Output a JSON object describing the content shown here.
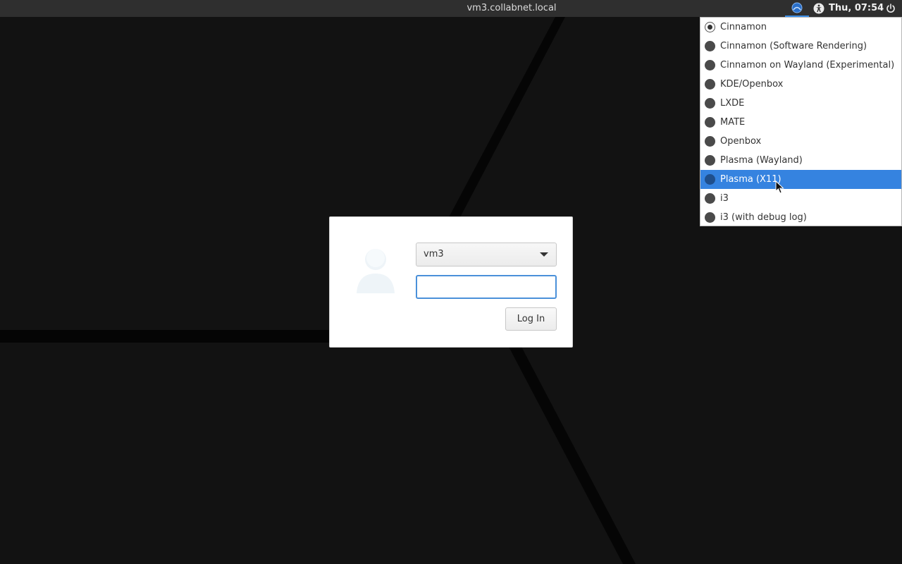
{
  "panel": {
    "hostname": "vm3.collabnet.local",
    "clock": "Thu, 07:54",
    "session_icon": "session-icon",
    "accessibility_icon": "accessibility-icon",
    "power_icon": "power-icon"
  },
  "session_menu": {
    "items": [
      {
        "label": "Cinnamon"
      },
      {
        "label": "Cinnamon (Software Rendering)"
      },
      {
        "label": "Cinnamon on Wayland (Experimental)"
      },
      {
        "label": "KDE/Openbox"
      },
      {
        "label": "LXDE"
      },
      {
        "label": "MATE"
      },
      {
        "label": "Openbox"
      },
      {
        "label": "Plasma (Wayland)"
      },
      {
        "label": "Plasma (X11)"
      },
      {
        "label": "i3"
      },
      {
        "label": "i3 (with debug log)"
      }
    ],
    "selected": "Cinnamon",
    "hovered": "Plasma (X11)"
  },
  "login": {
    "user": "vm3",
    "password_value": "",
    "login_label": "Log In"
  },
  "colors": {
    "accent": "#3583e0",
    "panel": "#2f2f2f",
    "background": "#111111"
  }
}
